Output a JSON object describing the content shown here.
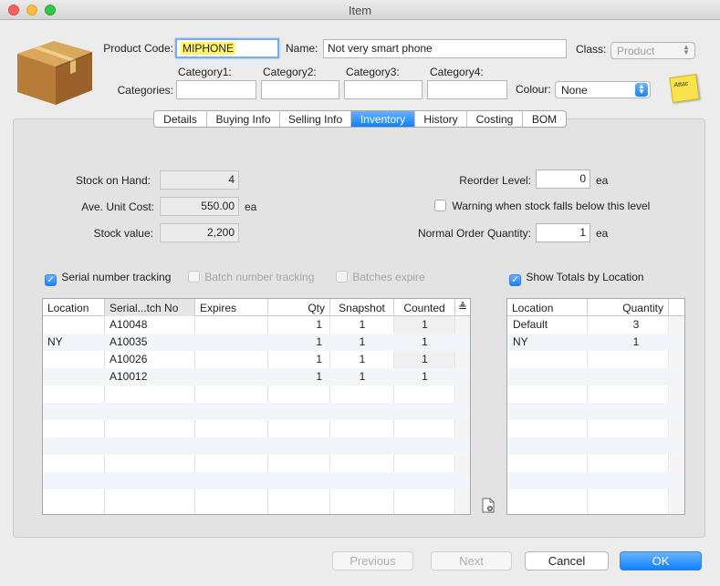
{
  "window": {
    "title": "Item"
  },
  "header": {
    "product_code_label": "Product Code:",
    "product_code_value": "MIPHONE",
    "name_label": "Name:",
    "name_value": "Not very smart phone",
    "class_label": "Class:",
    "class_value": "Product",
    "categories_label": "Categories:",
    "category1_label": "Category1:",
    "category2_label": "Category2:",
    "category3_label": "Category3:",
    "category4_label": "Category4:",
    "category1_value": "",
    "category2_value": "",
    "category3_value": "",
    "category4_value": "",
    "colour_label": "Colour:",
    "colour_value": "None",
    "sticky_text": "Attac"
  },
  "tabs": [
    {
      "label": "Details"
    },
    {
      "label": "Buying Info"
    },
    {
      "label": "Selling Info"
    },
    {
      "label": "Inventory",
      "active": true
    },
    {
      "label": "History"
    },
    {
      "label": "Costing"
    },
    {
      "label": "BOM"
    }
  ],
  "inventory": {
    "stock_on_hand_label": "Stock on Hand:",
    "stock_on_hand_value": "4",
    "ave_unit_cost_label": "Ave. Unit Cost:",
    "ave_unit_cost_value": "550.00",
    "ave_unit_cost_unit": "ea",
    "stock_value_label": "Stock value:",
    "stock_value_value": "2,200",
    "reorder_level_label": "Reorder Level:",
    "reorder_level_value": "0",
    "reorder_level_unit": "ea",
    "warning_label": "Warning when stock falls below this level",
    "warning_checked": false,
    "normal_order_qty_label": "Normal Order Quantity:",
    "normal_order_qty_value": "1",
    "normal_order_qty_unit": "ea",
    "serial_tracking_label": "Serial number tracking",
    "batch_tracking_label": "Batch number tracking",
    "batches_expire_label": "Batches expire",
    "show_totals_label": "Show Totals by Location"
  },
  "serial_table": {
    "columns": [
      "Location",
      "Serial...tch No",
      "Expires",
      "Qty",
      "Snapshot",
      "Counted"
    ],
    "sort_glyph": "≜",
    "rows": [
      {
        "location": "",
        "serial": "A10048",
        "expires": "",
        "qty": "1",
        "snapshot": "1",
        "counted": "1"
      },
      {
        "location": "NY",
        "serial": "A10035",
        "expires": "",
        "qty": "1",
        "snapshot": "1",
        "counted": "1"
      },
      {
        "location": "",
        "serial": "A10026",
        "expires": "",
        "qty": "1",
        "snapshot": "1",
        "counted": "1"
      },
      {
        "location": "",
        "serial": "A10012",
        "expires": "",
        "qty": "1",
        "snapshot": "1",
        "counted": "1"
      }
    ]
  },
  "totals_table": {
    "columns": [
      "Location",
      "Quantity"
    ],
    "rows": [
      {
        "location": "Default",
        "quantity": "3"
      },
      {
        "location": "NY",
        "quantity": "1"
      }
    ]
  },
  "footer": {
    "previous_label": "Previous",
    "next_label": "Next",
    "cancel_label": "Cancel",
    "ok_label": "OK"
  },
  "icons": {
    "product_box": "cardboard-box-icon",
    "add_document": "add-document-icon",
    "sticky_note": "sticky-note-icon"
  },
  "colors": {
    "accent": "#1a82fb",
    "highlight": "#fff36a"
  }
}
